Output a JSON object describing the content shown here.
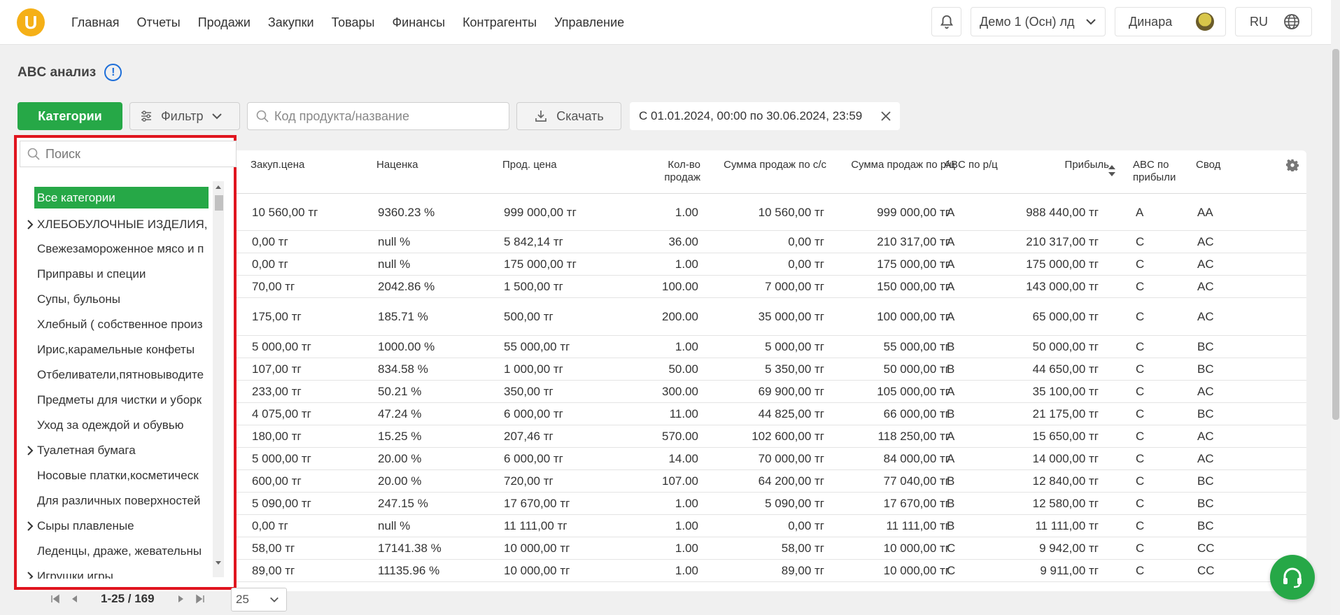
{
  "nav": {
    "logo": "U",
    "items": [
      "Главная",
      "Отчеты",
      "Продажи",
      "Закупки",
      "Товары",
      "Финансы",
      "Контрагенты",
      "Управление"
    ],
    "company": "Демо 1 (Осн) лд",
    "user": "Динара",
    "lang": "RU"
  },
  "page": {
    "title": "ABC анализ",
    "info_icon_text": "!"
  },
  "toolbar": {
    "categories_label": "Категории",
    "filter_label": "Фильтр",
    "search_placeholder": "Код продукта/название",
    "download_label": "Скачать",
    "date_range": "С 01.01.2024, 00:00 по 30.06.2024, 23:59"
  },
  "table": {
    "headers": {
      "purchase_price": "Закуп.цена",
      "markup": "Наценка",
      "sale_price": "Прод. цена",
      "qty": "Кол-во продаж",
      "sum_cost": "Сумма продаж по с/с",
      "sum_retail": "Сумма продаж по р/ц",
      "abc_retail": "ABC по р/ц",
      "profit": "Прибыль",
      "abc_profit": "ABC по прибыли",
      "summary": "Свод"
    },
    "rows": [
      {
        "purchase": "10 560,00 тг",
        "markup": "9360.23 %",
        "sale": "999 000,00 тг",
        "qty": "1.00",
        "sum_cost": "10 560,00 тг",
        "sum_retail": "999 000,00 тг",
        "abc_r": "A",
        "profit": "988 440,00 тг",
        "abc_p": "A",
        "svod": "AA"
      },
      {
        "purchase": "0,00 тг",
        "markup": "null %",
        "sale": "5 842,14 тг",
        "qty": "36.00",
        "sum_cost": "0,00 тг",
        "sum_retail": "210 317,00 тг",
        "abc_r": "A",
        "profit": "210 317,00 тг",
        "abc_p": "C",
        "svod": "AC"
      },
      {
        "purchase": "0,00 тг",
        "markup": "null %",
        "sale": "175 000,00 тг",
        "qty": "1.00",
        "sum_cost": "0,00 тг",
        "sum_retail": "175 000,00 тг",
        "abc_r": "A",
        "profit": "175 000,00 тг",
        "abc_p": "C",
        "svod": "AC"
      },
      {
        "purchase": "70,00 тг",
        "markup": "2042.86 %",
        "sale": "1 500,00 тг",
        "qty": "100.00",
        "sum_cost": "7 000,00 тг",
        "sum_retail": "150 000,00 тг",
        "abc_r": "A",
        "profit": "143 000,00 тг",
        "abc_p": "C",
        "svod": "AC"
      },
      {
        "purchase": "175,00 тг",
        "markup": "185.71 %",
        "sale": "500,00 тг",
        "qty": "200.00",
        "sum_cost": "35 000,00 тг",
        "sum_retail": "100 000,00 тг",
        "abc_r": "A",
        "profit": "65 000,00 тг",
        "abc_p": "C",
        "svod": "AC"
      },
      {
        "purchase": "5 000,00 тг",
        "markup": "1000.00 %",
        "sale": "55 000,00 тг",
        "qty": "1.00",
        "sum_cost": "5 000,00 тг",
        "sum_retail": "55 000,00 тг",
        "abc_r": "B",
        "profit": "50 000,00 тг",
        "abc_p": "C",
        "svod": "BC"
      },
      {
        "purchase": "107,00 тг",
        "markup": "834.58 %",
        "sale": "1 000,00 тг",
        "qty": "50.00",
        "sum_cost": "5 350,00 тг",
        "sum_retail": "50 000,00 тг",
        "abc_r": "B",
        "profit": "44 650,00 тг",
        "abc_p": "C",
        "svod": "BC"
      },
      {
        "purchase": "233,00 тг",
        "markup": "50.21 %",
        "sale": "350,00 тг",
        "qty": "300.00",
        "sum_cost": "69 900,00 тг",
        "sum_retail": "105 000,00 тг",
        "abc_r": "A",
        "profit": "35 100,00 тг",
        "abc_p": "C",
        "svod": "AC"
      },
      {
        "purchase": "4 075,00 тг",
        "markup": "47.24 %",
        "sale": "6 000,00 тг",
        "qty": "11.00",
        "sum_cost": "44 825,00 тг",
        "sum_retail": "66 000,00 тг",
        "abc_r": "B",
        "profit": "21 175,00 тг",
        "abc_p": "C",
        "svod": "BC"
      },
      {
        "purchase": "180,00 тг",
        "markup": "15.25 %",
        "sale": "207,46 тг",
        "qty": "570.00",
        "sum_cost": "102 600,00 тг",
        "sum_retail": "118 250,00 тг",
        "abc_r": "A",
        "profit": "15 650,00 тг",
        "abc_p": "C",
        "svod": "AC"
      },
      {
        "purchase": "5 000,00 тг",
        "markup": "20.00 %",
        "sale": "6 000,00 тг",
        "qty": "14.00",
        "sum_cost": "70 000,00 тг",
        "sum_retail": "84 000,00 тг",
        "abc_r": "A",
        "profit": "14 000,00 тг",
        "abc_p": "C",
        "svod": "AC"
      },
      {
        "purchase": "600,00 тг",
        "markup": "20.00 %",
        "sale": "720,00 тг",
        "qty": "107.00",
        "sum_cost": "64 200,00 тг",
        "sum_retail": "77 040,00 тг",
        "abc_r": "B",
        "profit": "12 840,00 тг",
        "abc_p": "C",
        "svod": "BC"
      },
      {
        "purchase": "5 090,00 тг",
        "markup": "247.15 %",
        "sale": "17 670,00 тг",
        "qty": "1.00",
        "sum_cost": "5 090,00 тг",
        "sum_retail": "17 670,00 тг",
        "abc_r": "B",
        "profit": "12 580,00 тг",
        "abc_p": "C",
        "svod": "BC"
      },
      {
        "purchase": "0,00 тг",
        "markup": "null %",
        "sale": "11 111,00 тг",
        "qty": "1.00",
        "sum_cost": "0,00 тг",
        "sum_retail": "11 111,00 тг",
        "abc_r": "B",
        "profit": "11 111,00 тг",
        "abc_p": "C",
        "svod": "BC"
      },
      {
        "purchase": "58,00 тг",
        "markup": "17141.38 %",
        "sale": "10 000,00 тг",
        "qty": "1.00",
        "sum_cost": "58,00 тг",
        "sum_retail": "10 000,00 тг",
        "abc_r": "C",
        "profit": "9 942,00 тг",
        "abc_p": "C",
        "svod": "CC"
      },
      {
        "purchase": "89,00 тг",
        "markup": "11135.96 %",
        "sale": "10 000,00 тг",
        "qty": "1.00",
        "sum_cost": "89,00 тг",
        "sum_retail": "10 000,00 тг",
        "abc_r": "C",
        "profit": "9 911,00 тг",
        "abc_p": "C",
        "svod": "CC"
      }
    ]
  },
  "categories_panel": {
    "search_placeholder": "Поиск",
    "items": [
      {
        "label": "Все категории",
        "selected": true,
        "expandable": false
      },
      {
        "label": "ХЛЕБОБУЛОЧНЫЕ ИЗДЕЛИЯ,",
        "selected": false,
        "expandable": true
      },
      {
        "label": "Свежезамороженное мясо и п",
        "selected": false,
        "expandable": false
      },
      {
        "label": "Приправы и специи",
        "selected": false,
        "expandable": false
      },
      {
        "label": "Супы, бульоны",
        "selected": false,
        "expandable": false
      },
      {
        "label": "Хлебный ( собственное произ",
        "selected": false,
        "expandable": false
      },
      {
        "label": "Ирис,карамельные конфеты",
        "selected": false,
        "expandable": false
      },
      {
        "label": "Отбеливатели,пятновыводите",
        "selected": false,
        "expandable": false
      },
      {
        "label": "Предметы для чистки и уборк",
        "selected": false,
        "expandable": false
      },
      {
        "label": "Уход за одеждой и обувью",
        "selected": false,
        "expandable": false
      },
      {
        "label": "Туалетная бумага",
        "selected": false,
        "expandable": true
      },
      {
        "label": "Носовые платки,косметическ",
        "selected": false,
        "expandable": false
      },
      {
        "label": "Для различных поверхностей",
        "selected": false,
        "expandable": false
      },
      {
        "label": "Сыры плавленые",
        "selected": false,
        "expandable": true
      },
      {
        "label": "Леденцы, драже, жевательны",
        "selected": false,
        "expandable": false
      },
      {
        "label": "Игрушки игры",
        "selected": false,
        "expandable": true
      }
    ]
  },
  "pagination": {
    "range": "1-25 / 169",
    "page_size": "25"
  }
}
